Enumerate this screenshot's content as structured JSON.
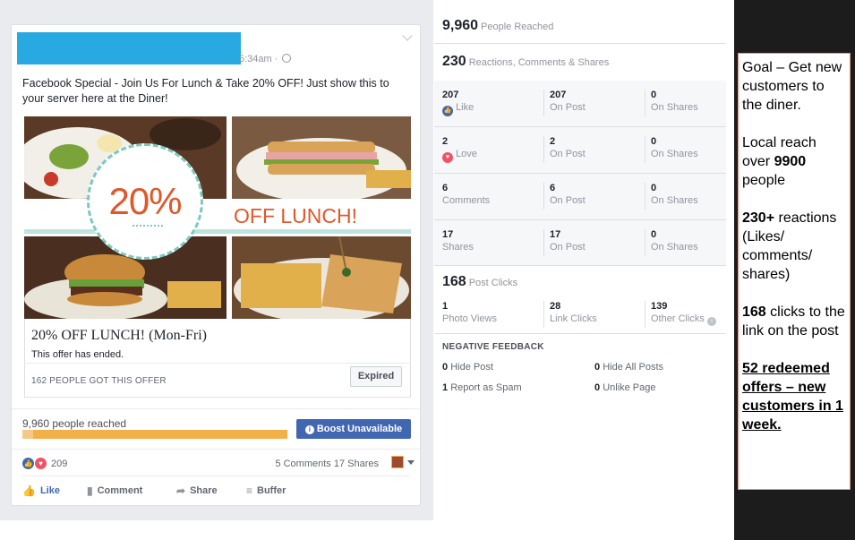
{
  "post": {
    "time": "5:34am ·",
    "text": "Facebook Special - Join Us For Lunch & Take 20% OFF! Just show this to your server here at the Diner!",
    "image": {
      "percent": "20%",
      "off_text": "OFF LUNCH!"
    },
    "offer": {
      "title": "20% OFF LUNCH! (Mon-Fri)",
      "status": "This offer has ended.",
      "count": "162 PEOPLE GOT THIS OFFER",
      "button": "Expired"
    },
    "reach": {
      "label": "9,960 people reached",
      "fill_fraction": 0.04
    },
    "boost_label": "Boost Unavailable",
    "reactions_count": "209",
    "comments_shares": "5 Comments  17 Shares",
    "actions": {
      "like": "Like",
      "comment": "Comment",
      "share": "Share",
      "buffer": "Buffer"
    },
    "icons": [
      "globe-icon",
      "chevron-down-icon",
      "info-icon",
      "like-react-icon",
      "love-react-icon",
      "thumbs-up-icon",
      "comment-icon",
      "share-arrow-icon",
      "buffer-icon"
    ]
  },
  "insights": {
    "reached": {
      "value": "9,960",
      "label": "People Reached"
    },
    "reactions": {
      "value": "230",
      "label": "Reactions, Comments & Shares"
    },
    "rows": [
      {
        "a_num": "207",
        "a_label": "Like",
        "b_num": "207",
        "b_label": "On Post",
        "c_num": "0",
        "c_label": "On Shares"
      },
      {
        "a_num": "2",
        "a_label": "Love",
        "b_num": "2",
        "b_label": "On Post",
        "c_num": "0",
        "c_label": "On Shares"
      },
      {
        "a_num": "6",
        "a_label": "Comments",
        "b_num": "6",
        "b_label": "On Post",
        "c_num": "0",
        "c_label": "On Shares"
      },
      {
        "a_num": "17",
        "a_label": "Shares",
        "b_num": "17",
        "b_label": "On Post",
        "c_num": "0",
        "c_label": "On Shares"
      }
    ],
    "clicks": {
      "value": "168",
      "label": "Post Clicks"
    },
    "click_breakdown": [
      {
        "num": "1",
        "label": "Photo Views"
      },
      {
        "num": "28",
        "label": "Link Clicks"
      },
      {
        "num": "139",
        "label": "Other Clicks"
      }
    ],
    "negative": {
      "title": "NEGATIVE FEEDBACK",
      "items": [
        {
          "num": "0",
          "label": "Hide Post"
        },
        {
          "num": "0",
          "label": "Hide All Posts"
        },
        {
          "num": "1",
          "label": "Report as Spam"
        },
        {
          "num": "0",
          "label": "Unlike Page"
        }
      ]
    }
  },
  "goal": {
    "line1": "Goal – Get new customers to the diner.",
    "reach_pre": "Local reach over ",
    "reach_num": "9900",
    "reach_post": " people",
    "reactions_num": "230+",
    "reactions_post": " reactions (Likes/ comments/ shares)",
    "clicks_num": "168",
    "clicks_post": " clicks to the link on the post",
    "highlight": "52 redeemed offers – new customers in 1 week."
  },
  "colors": {
    "facebook_blue": "#4267b2",
    "offer_orange": "#e0582a",
    "reach_bar": "#f2b04a",
    "love_red": "#f25268",
    "goal_border": "#e88f7d",
    "redaction": "#29a9e1"
  }
}
